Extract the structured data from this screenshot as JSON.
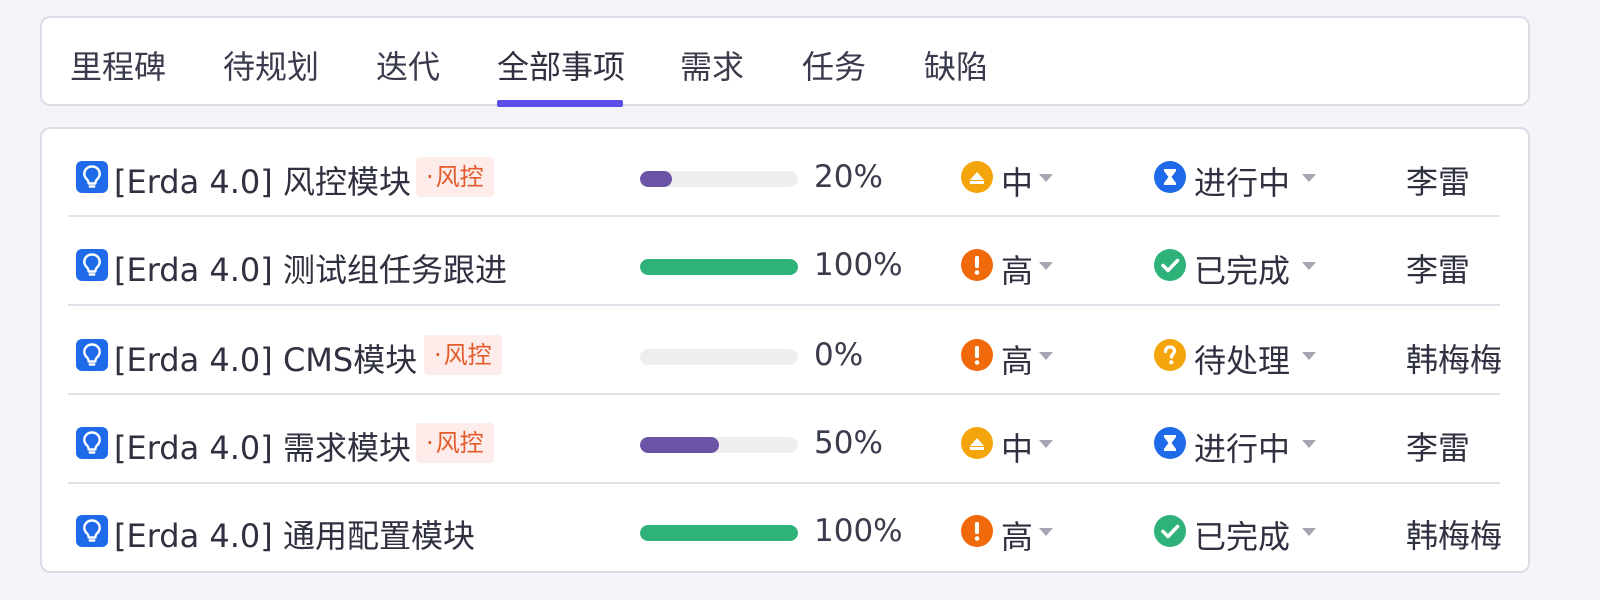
{
  "tabs": [
    {
      "label": "里程碑"
    },
    {
      "label": "待规划"
    },
    {
      "label": "迭代"
    },
    {
      "label": "全部事项",
      "active": true
    },
    {
      "label": "需求"
    },
    {
      "label": "任务"
    },
    {
      "label": "缺陷"
    }
  ],
  "colors": {
    "accent": "#5b4fe9",
    "progress_in_progress": "#6b54a6",
    "progress_done": "#2fb27a",
    "priority_medium": "#f5a50c",
    "priority_high": "#f06a0c",
    "status_in_progress": "#1f6ae8",
    "status_done": "#2fb27a",
    "status_pending": "#f5a50c",
    "tag_bg": "#fdecea",
    "tag_text": "#e35b2b"
  },
  "rows": [
    {
      "type_icon": "lightbulb-icon",
      "title": "[Erda 4.0] 风控模块",
      "tag": "风控",
      "progress": 20,
      "progress_text": "20%",
      "priority": {
        "label": "中",
        "icon": "priority-medium-icon"
      },
      "status": {
        "label": "进行中",
        "icon": "hourglass-icon"
      },
      "assignee": "李雷"
    },
    {
      "type_icon": "lightbulb-icon",
      "title": "[Erda 4.0] 测试组任务跟进",
      "tag": "",
      "progress": 100,
      "progress_text": "100%",
      "priority": {
        "label": "高",
        "icon": "priority-high-icon"
      },
      "status": {
        "label": "已完成",
        "icon": "check-circle-icon"
      },
      "assignee": "李雷"
    },
    {
      "type_icon": "lightbulb-icon",
      "title": "[Erda 4.0] CMS模块",
      "tag": "风控",
      "progress": 0,
      "progress_text": "0%",
      "priority": {
        "label": "高",
        "icon": "priority-high-icon"
      },
      "status": {
        "label": "待处理",
        "icon": "question-circle-icon"
      },
      "assignee": "韩梅梅"
    },
    {
      "type_icon": "lightbulb-icon",
      "title": "[Erda 4.0] 需求模块",
      "tag": "风控",
      "progress": 50,
      "progress_text": "50%",
      "priority": {
        "label": "中",
        "icon": "priority-medium-icon"
      },
      "status": {
        "label": "进行中",
        "icon": "hourglass-icon"
      },
      "assignee": "李雷"
    },
    {
      "type_icon": "lightbulb-icon",
      "title": "[Erda 4.0] 通用配置模块",
      "tag": "",
      "progress": 100,
      "progress_text": "100%",
      "priority": {
        "label": "高",
        "icon": "priority-high-icon"
      },
      "status": {
        "label": "已完成",
        "icon": "check-circle-icon"
      },
      "assignee": "韩梅梅"
    }
  ]
}
